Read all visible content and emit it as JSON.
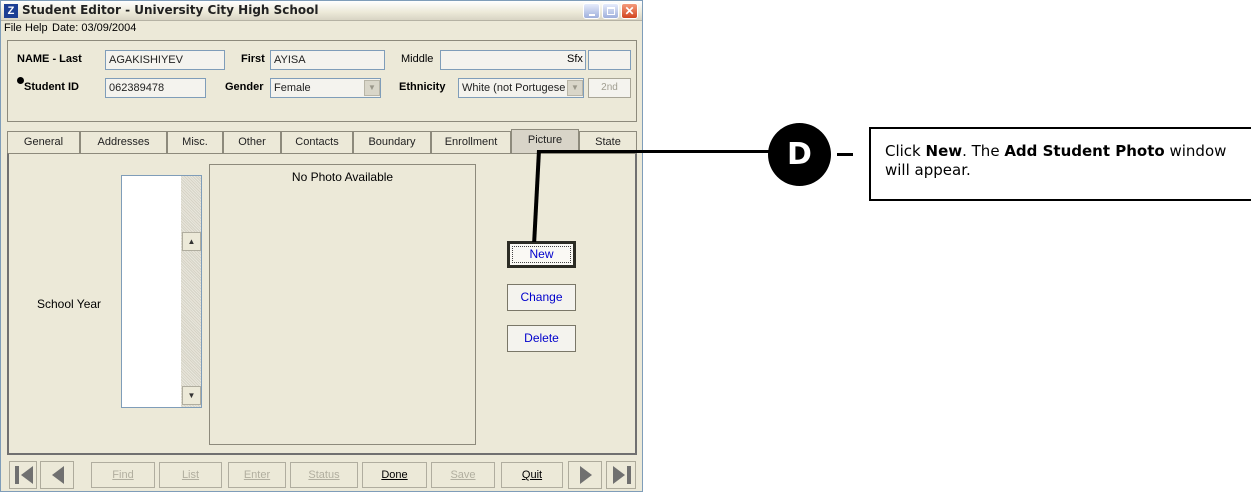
{
  "window": {
    "title": "Student Editor - University City High School",
    "app_icon": "Z"
  },
  "menubar": {
    "file": "File",
    "help": "Help",
    "date": "Date: 03/09/2004"
  },
  "student": {
    "last_label": "NAME - Last",
    "last_value": "AGAKISHIYEV",
    "first_label": "First",
    "first_value": "AYISA",
    "middle_label": "Middle",
    "middle_value": "",
    "sfx_label": "Sfx",
    "sfx_value": "",
    "id_label": "Student ID",
    "id_value": "062389478",
    "gender_label": "Gender",
    "gender_value": "Female",
    "ethnicity_label": "Ethnicity",
    "ethnicity_value": "White (not Portugese",
    "second_button": "2nd"
  },
  "tabs": [
    "General",
    "Addresses",
    "Misc.",
    "Other",
    "Contacts",
    "Boundary",
    "Enrollment",
    "Picture",
    "State"
  ],
  "active_tab": "Picture",
  "picture": {
    "school_year_label": "School Year",
    "no_photo": "No Photo Available",
    "new_button": "New",
    "change_button": "Change",
    "delete_button": "Delete"
  },
  "toolbar": {
    "find": "Find",
    "list": "List",
    "enter": "Enter",
    "status": "Status",
    "done": "Done",
    "save": "Save",
    "quit": "Quit"
  },
  "callout": {
    "letter": "D",
    "text_parts": [
      "Click ",
      "New",
      ". The ",
      "Add Student Photo",
      " window will appear."
    ]
  }
}
